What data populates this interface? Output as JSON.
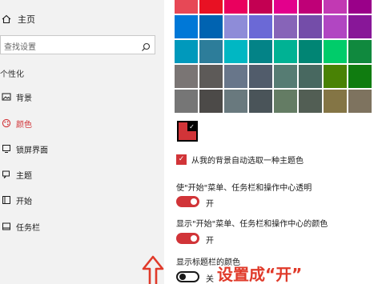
{
  "sidebar": {
    "home_label": "主页",
    "search_placeholder": "查找设置",
    "section_title": "个性化",
    "items": [
      {
        "label": "背景",
        "icon": "picture-icon"
      },
      {
        "label": "颜色",
        "icon": "palette-icon",
        "active": true
      },
      {
        "label": "锁屏界面",
        "icon": "lock-screen-icon"
      },
      {
        "label": "主题",
        "icon": "brush-icon"
      },
      {
        "label": "开始",
        "icon": "start-icon"
      },
      {
        "label": "任务栏",
        "icon": "taskbar-icon"
      }
    ]
  },
  "colors": {
    "accent": "#d13438",
    "palette": [
      [
        "#e74856",
        "#e81123",
        "#ea005e",
        "#c30052",
        "#e3008c",
        "#bf0077",
        "#c239b3",
        "#9a0089"
      ],
      [
        "#0078d7",
        "#0063b1",
        "#8e8cd8",
        "#6b69d6",
        "#8764b8",
        "#744da9",
        "#b146c2",
        "#881798"
      ],
      [
        "#0099bc",
        "#2d7d9a",
        "#00b7c3",
        "#038387",
        "#00b294",
        "#018574",
        "#00cc6a",
        "#10893e"
      ],
      [
        "#7a7574",
        "#5d5a58",
        "#68768a",
        "#515c6b",
        "#567c73",
        "#486860",
        "#498205",
        "#107c10"
      ],
      [
        "#767676",
        "#4c4a48",
        "#69797e",
        "#4a5459",
        "#647c64",
        "#525e54",
        "#847545",
        "#7e735f"
      ]
    ],
    "selected_color": "#d13438"
  },
  "settings": {
    "auto_pick_label": "从我的背景自动选取一种主题色",
    "transparency_label": "使\"开始\"菜单、任务栏和操作中心透明",
    "transparency_state": "开",
    "show_color_start_label": "显示\"开始\"菜单、任务栏和操作中心的颜色",
    "show_color_start_state": "开",
    "title_bar_label": "显示标题栏的颜色",
    "title_bar_state": "关"
  },
  "annotation": {
    "text": "设置成“开”"
  }
}
